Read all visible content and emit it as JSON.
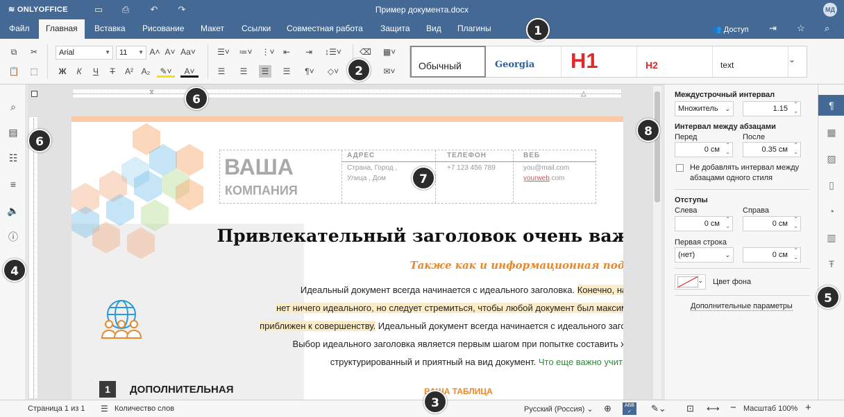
{
  "app": {
    "brand": "ONLYOFFICE",
    "doc_title": "Пример документа.docx",
    "avatar": "МД"
  },
  "quick_access": {
    "save_icon": "save-icon",
    "print_icon": "print-icon",
    "undo_icon": "undo-icon",
    "redo_icon": "redo-icon"
  },
  "menu": {
    "tabs": [
      {
        "label": "Файл"
      },
      {
        "label": "Главная",
        "active": true
      },
      {
        "label": "Вставка"
      },
      {
        "label": "Рисование"
      },
      {
        "label": "Макет"
      },
      {
        "label": "Ссылки"
      },
      {
        "label": "Совместная работа"
      },
      {
        "label": "Защита"
      },
      {
        "label": "Вид"
      },
      {
        "label": "Плагины"
      }
    ],
    "access_label": "Доступ"
  },
  "toolbar": {
    "font_name": "Arial",
    "font_size": "11",
    "bold": "Ж",
    "italic": "К",
    "underline": "Ч",
    "strike": "Т",
    "superscript": "A²",
    "subscript": "A₂",
    "styles": [
      {
        "label": "Обычный"
      },
      {
        "label": "Georgia"
      },
      {
        "label": "H1"
      },
      {
        "label": "H2"
      },
      {
        "label": "text"
      }
    ]
  },
  "accent_color": "#446995",
  "document": {
    "company_main": "ВАША",
    "company_sub": "КОМПАНИЯ",
    "address_label": "АДРЕС",
    "address_line1": "Страна, Город ,",
    "address_line2": "Улица , Дом",
    "phone_label": "ТЕЛЕФОН",
    "phone": "+7 123 456 789",
    "web_label": "ВЕБ",
    "email": "you@mail.com",
    "site_link": "yourweb",
    "site_tail": ".com",
    "title": "Привлекательный заголовок очень важен",
    "subtitle": "Также как и информационная подпись",
    "p1": "Идеальный документ всегда начинается с идеального заголовка.",
    "p1_hl": "Конечно, на свете",
    "p2_hl": "нет ничего идеального, но следует стремиться, чтобы любой документ был максимально",
    "p3_hl": "приближен к совершенству.",
    "p3": "Идеальный документ всегда начинается с идеального заголовка.",
    "p4": "Выбор идеального заголовка является первым шагом при попытке составить хорошо",
    "p5": "структурированный и приятный на вид документ.",
    "p5_link": "Что еще важно учитывать",
    "p5_end": "?",
    "section_num": "1",
    "section_title": "ДОПОЛНИТЕЛЬНАЯ",
    "table_caption": "ВАША ТАБЛИЦА"
  },
  "right_panel": {
    "line_spacing_label": "Междустрочный интервал",
    "line_spacing_mode": "Множитель",
    "line_spacing_value": "1.15",
    "para_spacing_label": "Интервал между абзацами",
    "before_label": "Перед",
    "after_label": "После",
    "before_value": "0 см",
    "after_value": "0.35 см",
    "no_space_label_1": "Не добавлять интервал между",
    "no_space_label_2": "абзацами одного стиля",
    "indents_label": "Отступы",
    "left_label": "Слева",
    "right_label": "Справа",
    "left_value": "0 см",
    "right_value": "0 см",
    "first_line_label": "Первая строка",
    "first_line_mode": "(нет)",
    "first_line_value": "0 см",
    "bg_color_label": "Цвет фона",
    "advanced_label": "Дополнительные параметры"
  },
  "status": {
    "page": "Страница 1 из 1",
    "word_count": "Количество слов",
    "language": "Русский (Россия)",
    "zoom": "Масштаб 100%"
  },
  "callouts": [
    "1",
    "2",
    "3",
    "4",
    "5",
    "6",
    "6",
    "7",
    "8"
  ]
}
